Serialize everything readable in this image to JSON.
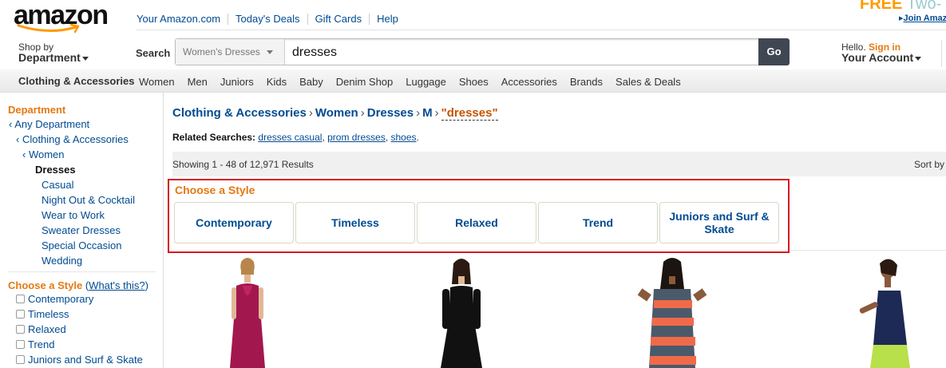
{
  "header": {
    "logo": "amazon",
    "top_links": [
      "Your Amazon.com",
      "Today's Deals",
      "Gift Cards",
      "Help"
    ],
    "promo_free": "FREE",
    "promo_rest": "Two-",
    "promo_join": "Join Amaz",
    "shop_by_line1": "Shop by",
    "shop_by_line2": "Department",
    "search_label": "Search",
    "search_category": "Women's Dresses",
    "search_value": "dresses",
    "go_label": "Go",
    "hello": "Hello.",
    "sign_in": "Sign in",
    "your_account": "Your Account"
  },
  "catbar": {
    "store": "Clothing & Accessories",
    "items": [
      "Women",
      "Men",
      "Juniors",
      "Kids",
      "Baby",
      "Denim Shop",
      "Luggage",
      "Shoes",
      "Accessories",
      "Brands",
      "Sales & Deals"
    ]
  },
  "leftnav": {
    "department_heading": "Department",
    "any_department": "‹ Any Department",
    "clothing": "‹ Clothing & Accessories",
    "women": "‹ Women",
    "current": "Dresses",
    "subcategories": [
      "Casual",
      "Night Out & Cocktail",
      "Wear to Work",
      "Sweater Dresses",
      "Special Occasion",
      "Wedding"
    ],
    "style_heading": "Choose a Style",
    "whats_this": "What's this?",
    "style_options": [
      "Contemporary",
      "Timeless",
      "Relaxed",
      "Trend",
      "Juniors and Surf & Skate"
    ]
  },
  "main": {
    "breadcrumb": [
      "Clothing & Accessories",
      "Women",
      "Dresses",
      "M"
    ],
    "breadcrumb_query": "\"dresses\"",
    "related_label": "Related Searches:",
    "related_links": [
      "dresses casual",
      "prom dresses",
      "shoes"
    ],
    "results_text": "Showing 1 - 48 of 12,971 Results",
    "sort_label": "Sort by",
    "choose_style_title": "Choose a Style",
    "style_buttons": [
      "Contemporary",
      "Timeless",
      "Relaxed",
      "Trend",
      "Juniors and Surf & Skate"
    ]
  },
  "colors": {
    "link": "#004b91",
    "accent_orange": "#e47911",
    "highlight_red": "#d71920",
    "go_button": "#3f4752"
  }
}
